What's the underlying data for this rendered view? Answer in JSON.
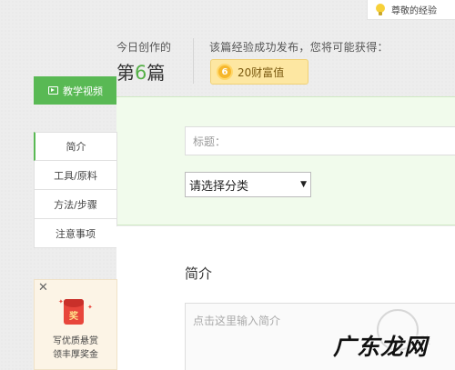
{
  "notice": {
    "text": "尊敬的经验"
  },
  "stats": {
    "today_label": "今日创作的",
    "count_prefix": "第",
    "count_number": "6",
    "count_suffix": "篇",
    "reward_text": "该篇经验成功发布，您将可能获得：",
    "reward_coin": "6",
    "reward_value": "20财富值"
  },
  "video_button": {
    "label": "教学视频"
  },
  "form": {
    "title_placeholder": "标题：",
    "category_select": {
      "selected": "请选择分类",
      "arrow": "▼"
    },
    "intro_heading": "简介",
    "intro_placeholder": "点击这里输入简介"
  },
  "sidebar": {
    "items": [
      {
        "label": "简介"
      },
      {
        "label": "工具/原料"
      },
      {
        "label": "方法/步骤"
      },
      {
        "label": "注意事项"
      }
    ]
  },
  "promo": {
    "close": "✕",
    "badge": "奖",
    "line1": "写优质悬赏",
    "line2": "领丰厚奖金"
  },
  "watermark": {
    "text": "广东龙网",
    "small": "验"
  },
  "colors": {
    "accent_green": "#59b954",
    "reward_bg": "#fde7a2",
    "coin": "#f6b72c",
    "redpack": "#e8463c"
  }
}
